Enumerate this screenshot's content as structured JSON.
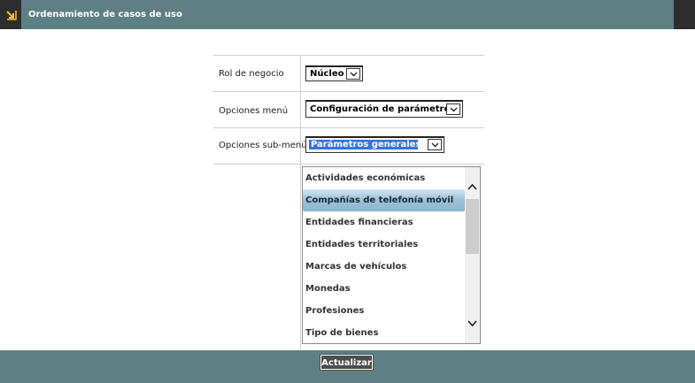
{
  "window": {
    "title": "Ordenamiento de casos de uso",
    "icon": "expand-arrow-icon"
  },
  "form": {
    "rol_label": "Rol de negocio",
    "rol_value": "Núcleo",
    "menu_label": "Opciones menú",
    "menu_value": "Configuración de parámetros",
    "submenu_label": "Opciones sub-menú",
    "submenu_value": "Parámetros generales"
  },
  "list": {
    "items": [
      "Actividades económicas",
      "Compañías de telefonía móvil",
      "Entidades financieras",
      "Entidades territoriales",
      "Marcas de vehículos",
      "Monedas",
      "Profesiones",
      "Tipo de bienes"
    ],
    "selected_index": 1
  },
  "footer": {
    "update_label": "Actualizar"
  },
  "colors": {
    "bar": "#5f7f85",
    "accent": "#3874d8"
  }
}
